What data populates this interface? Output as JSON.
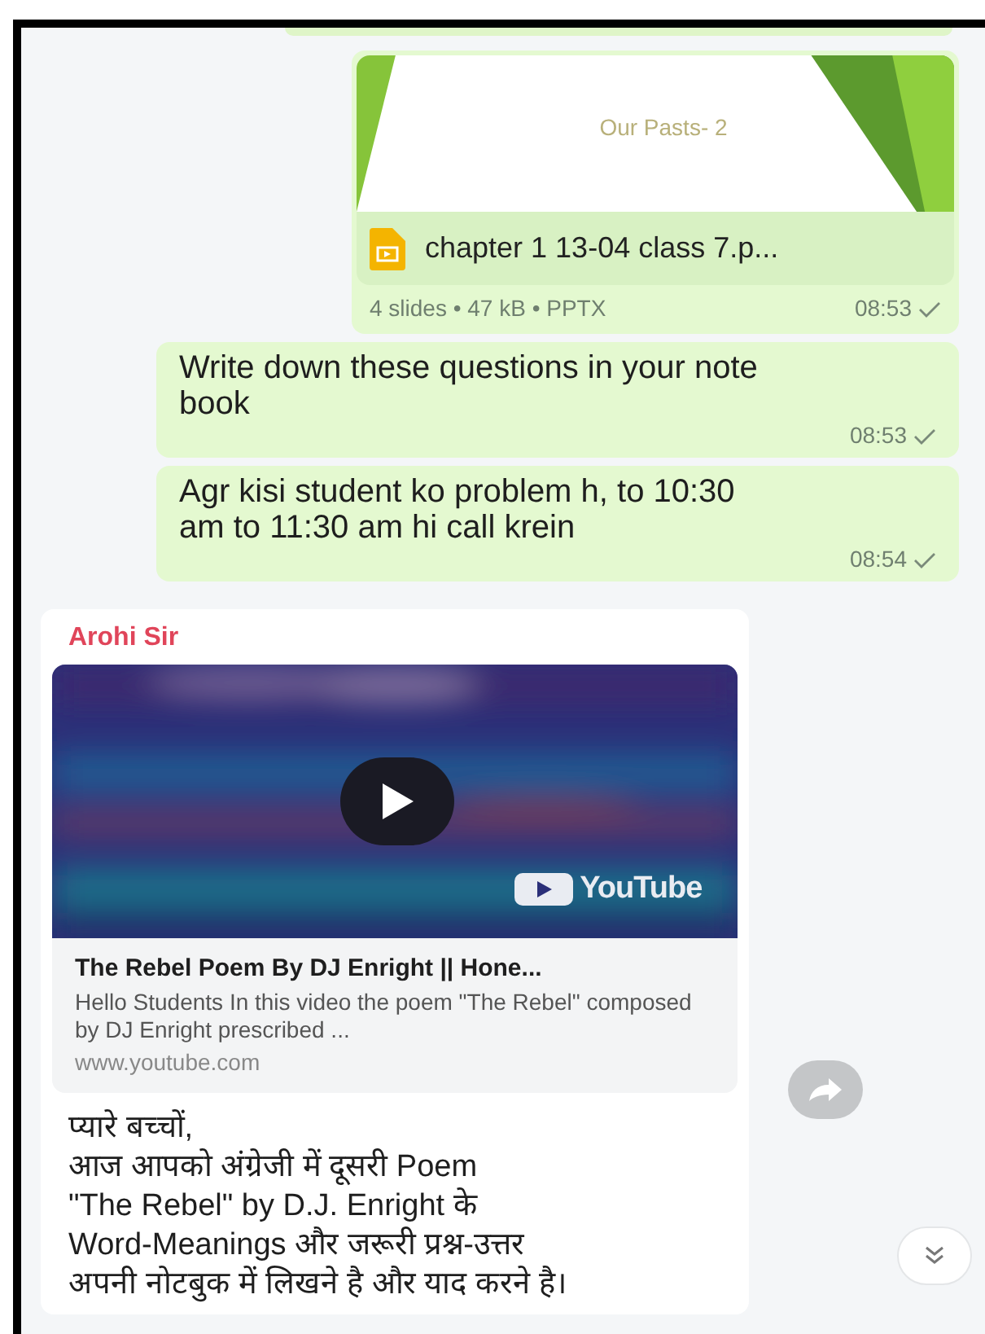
{
  "messages": [
    {
      "kind": "file",
      "slide_title": "Our Pasts- 2",
      "file_name": "chapter 1 13-04 class 7.p...",
      "meta": "4 slides • 47 kB • PPTX",
      "time": "08:53"
    },
    {
      "kind": "text",
      "text": "Write down these questions in your note book",
      "time": "08:53"
    },
    {
      "kind": "text",
      "text": "Agr kisi student ko problem h, to 10:30 am to 11:30 am hi call krein",
      "time": "08:54"
    },
    {
      "kind": "link",
      "sender": "Arohi Sir",
      "video_badge": "YouTube",
      "link_title": "The Rebel Poem By DJ Enright || Hone...",
      "link_desc": "Hello Students In this video the poem \"The Rebel\" composed by DJ Enright prescribed ...",
      "link_url": "www.youtube.com",
      "lines": [
        "प्यारे बच्चों,",
        "आज आपको अंग्रेजी में दूसरी Poem",
        "\"The Rebel\" by D.J. Enright के",
        "Word-Meanings और जरूरी प्रश्न-उत्तर",
        "अपनी नोटबुक में लिखने है और याद करने है।"
      ]
    }
  ]
}
